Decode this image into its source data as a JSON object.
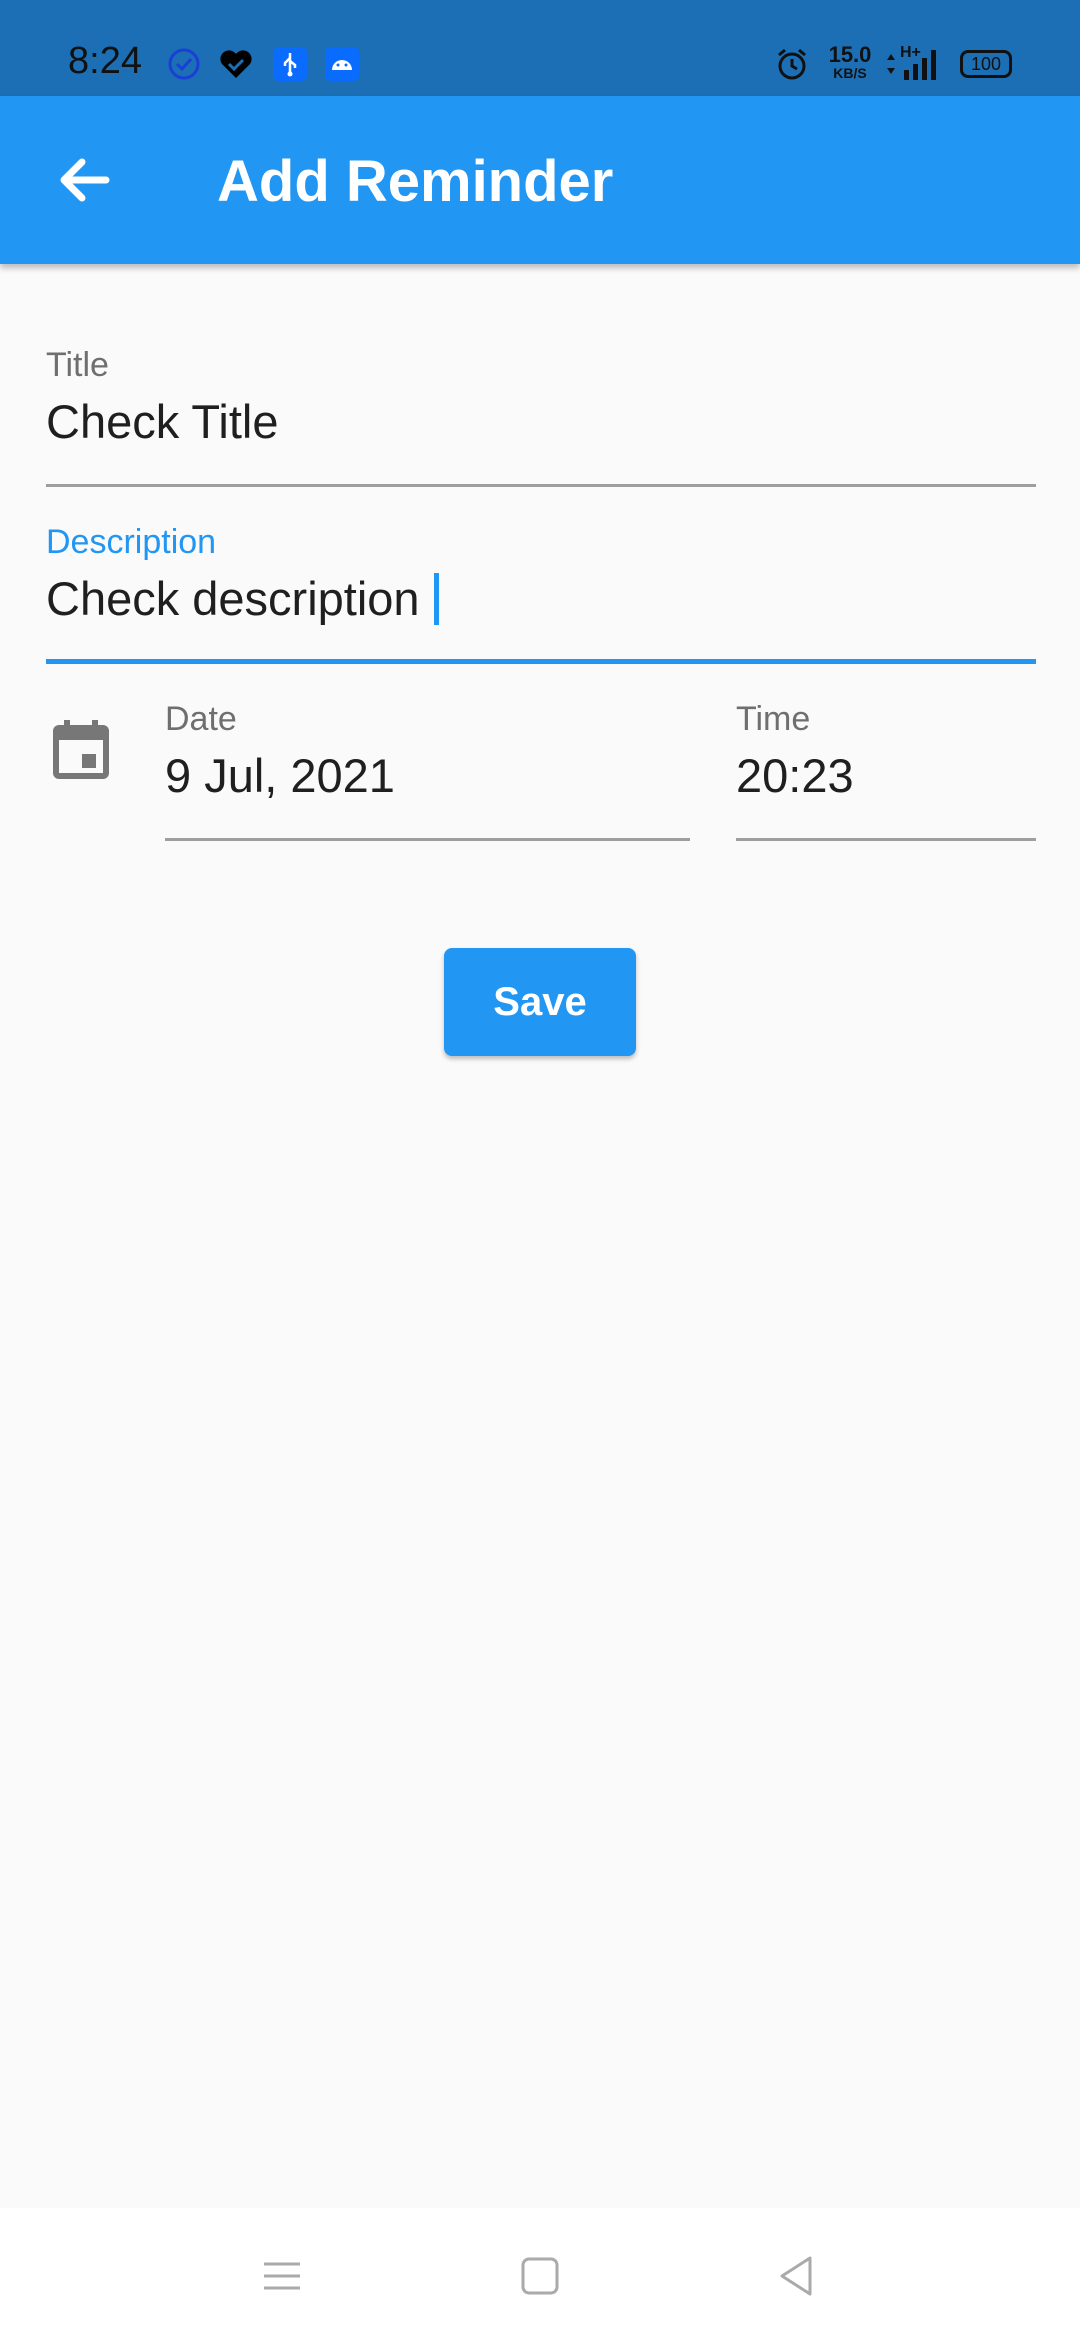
{
  "status_bar": {
    "time": "8:24",
    "net_speed_value": "15.0",
    "net_speed_unit": "KB/S",
    "network_type": "H+",
    "battery": "100",
    "icons": [
      "clock-check-icon",
      "heart-check-icon",
      "usb-icon",
      "android-icon",
      "alarm-icon",
      "signal-icon",
      "battery-icon"
    ]
  },
  "app_bar": {
    "title": "Add Reminder",
    "back_icon": "arrow-left-icon"
  },
  "form": {
    "title_label": "Title",
    "title_value": "Check Title",
    "description_label": "Description",
    "description_value": "Check description",
    "date_label": "Date",
    "date_value": "9 Jul, 2021",
    "time_label": "Time",
    "time_value": "20:23",
    "calendar_icon": "calendar-icon"
  },
  "actions": {
    "save_label": "Save"
  },
  "nav_bar": {
    "icons": [
      "menu-icon",
      "home-square-icon",
      "back-triangle-icon"
    ]
  },
  "colors": {
    "primary": "#2196f3",
    "status_bar": "#1c6fb5",
    "background": "#fafafa"
  }
}
